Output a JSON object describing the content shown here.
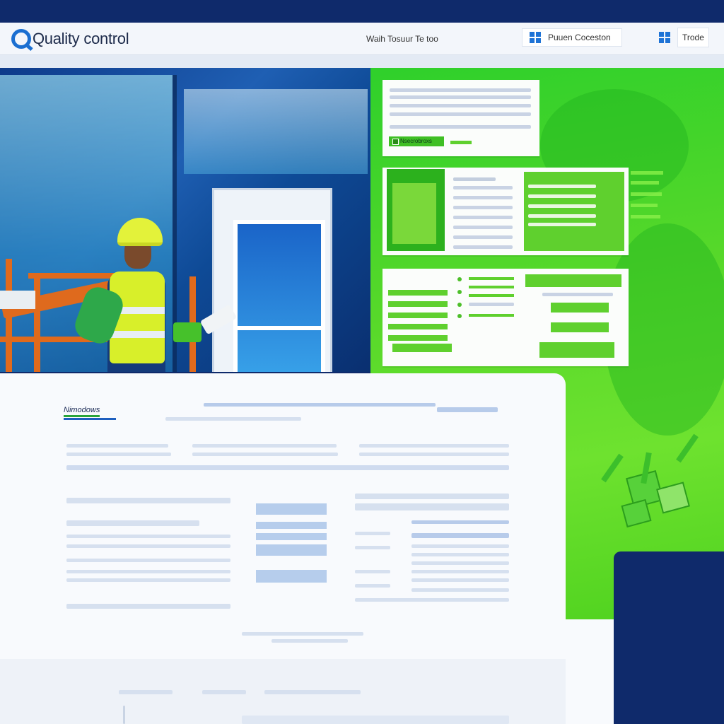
{
  "app": {
    "title_prefix": "Quality",
    "title_suffix": "control"
  },
  "header": {
    "link": "Waih  Tosuur  Te too",
    "pill1": "Puuen  Coceston",
    "pill2": "Trode"
  },
  "dashboard": {
    "card1_button": "Nsecrobroxs"
  },
  "document": {
    "logo": "Nimodows"
  },
  "colors": {
    "navy": "#0f2a6b",
    "green": "#4fd21f",
    "accent_blue": "#1e73d6"
  },
  "icons": [
    "windows-logo-icon",
    "quality-q-icon"
  ]
}
